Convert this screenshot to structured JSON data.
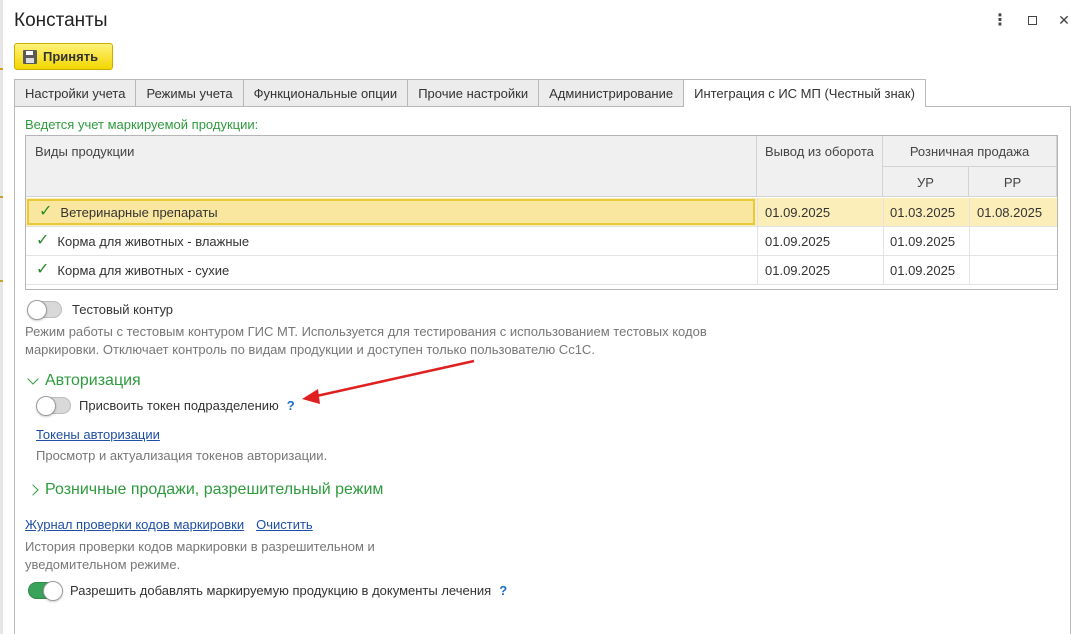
{
  "window": {
    "title": "Константы",
    "menu_icon": "more-vertical-icon",
    "maximize_icon": "maximize-icon",
    "close_icon": "close-icon"
  },
  "toolbar": {
    "accept_label": "Принять",
    "accept_icon": "save-icon",
    "accent_color": "#f2d600"
  },
  "tabs": [
    {
      "label": "Настройки учета",
      "active": false
    },
    {
      "label": "Режимы учета",
      "active": false
    },
    {
      "label": "Функциональные опции",
      "active": false
    },
    {
      "label": "Прочие настройки",
      "active": false
    },
    {
      "label": "Администрирование",
      "active": false
    },
    {
      "label": "Интеграция с ИС МП (Честный знак)",
      "active": true
    }
  ],
  "marking": {
    "section_label": "Ведется учет маркируемой продукции:",
    "columns": {
      "product_type": "Виды продукции",
      "withdrawal": "Вывод из оборота",
      "retail": "Розничная продажа",
      "ur": "УР",
      "rr": "РР"
    },
    "rows": [
      {
        "name": "Ветеринарные препараты",
        "withdrawal": "01.09.2025",
        "ur": "01.03.2025",
        "rr": "01.08.2025",
        "selected": true
      },
      {
        "name": "Корма для животных - влажные",
        "withdrawal": "01.09.2025",
        "ur": "01.09.2025",
        "rr": "",
        "selected": false
      },
      {
        "name": "Корма для животных - сухие",
        "withdrawal": "01.09.2025",
        "ur": "01.09.2025",
        "rr": "",
        "selected": false
      }
    ]
  },
  "test_contour": {
    "label": "Тестовый контур",
    "enabled": false,
    "hint_line1": "Режим работы с тестовым контуром ГИС МТ. Используется для тестирования с использованием тестовых кодов",
    "hint_line2": "маркировки. Отключает контроль по видам продукции и доступен только пользователю Сс1С."
  },
  "authorization": {
    "title": "Авторизация",
    "expanded": true,
    "assign_token_label": "Присвоить токен подразделению",
    "assign_token_enabled": false,
    "help_mark": "?",
    "tokens_link": "Токены авторизации",
    "tokens_hint": "Просмотр и актуализация токенов авторизации."
  },
  "retail_permissive": {
    "title": "Розничные продажи, разрешительный режим",
    "expanded": false
  },
  "journal": {
    "link": "Журнал проверки кодов маркировки",
    "clear_link": "Очистить",
    "hint_line1": "История проверки кодов маркировки в разрешительном и",
    "hint_line2": "уведомительном режиме."
  },
  "allow_treatment": {
    "label": "Разрешить добавлять маркируемую продукцию в документы лечения",
    "enabled": true,
    "help_mark": "?"
  },
  "colors": {
    "section_green": "#2e9b3e",
    "link_blue": "#1f4fa3",
    "arrow_red": "#e02020",
    "selected_row": "#fbeeb8"
  }
}
